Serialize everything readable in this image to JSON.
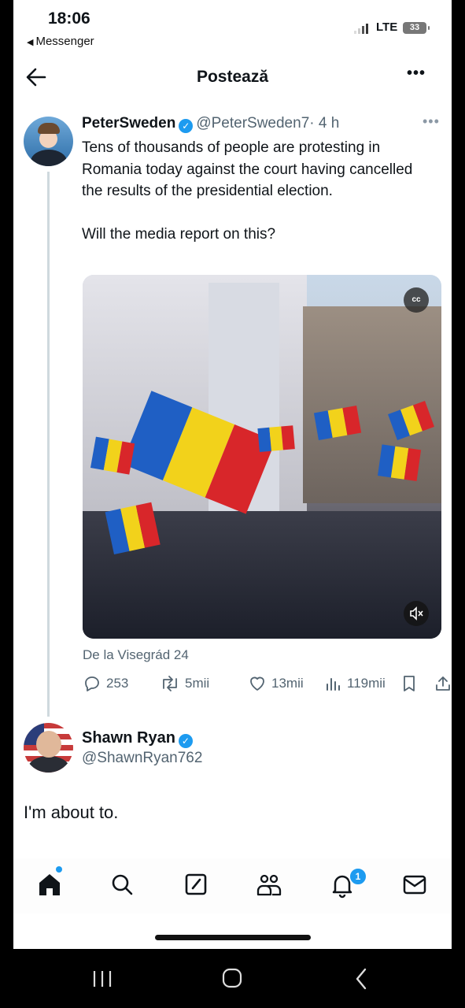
{
  "status_bar": {
    "time": "18:06",
    "back_app": "Messenger",
    "network": "LTE",
    "battery": "33"
  },
  "header": {
    "title": "Postează"
  },
  "tweet": {
    "author_name": "PeterSweden",
    "handle": "@PeterSweden7",
    "time": "· 4 h",
    "text_lines": [
      "Tens of thousands of people are protesting in Romania today against the court having cancelled the results of the presidential election.",
      "Will the media report on this?"
    ],
    "media_cc_label": "cc",
    "source": "De la Visegrád 24",
    "stats": {
      "replies": "253",
      "retweets": "5mii",
      "likes": "13mii",
      "views": "119mii"
    }
  },
  "reply": {
    "author_name": "Shawn Ryan",
    "handle": "@ShawnRyan762",
    "text": "I'm about to."
  },
  "tabbar": {
    "notifications_badge": "1",
    "items": [
      "home-icon",
      "search-icon",
      "compose-icon",
      "communities-icon",
      "notifications-icon",
      "messages-icon"
    ]
  },
  "colors": {
    "accent": "#1d9bf0",
    "secondary_text": "#536471"
  }
}
